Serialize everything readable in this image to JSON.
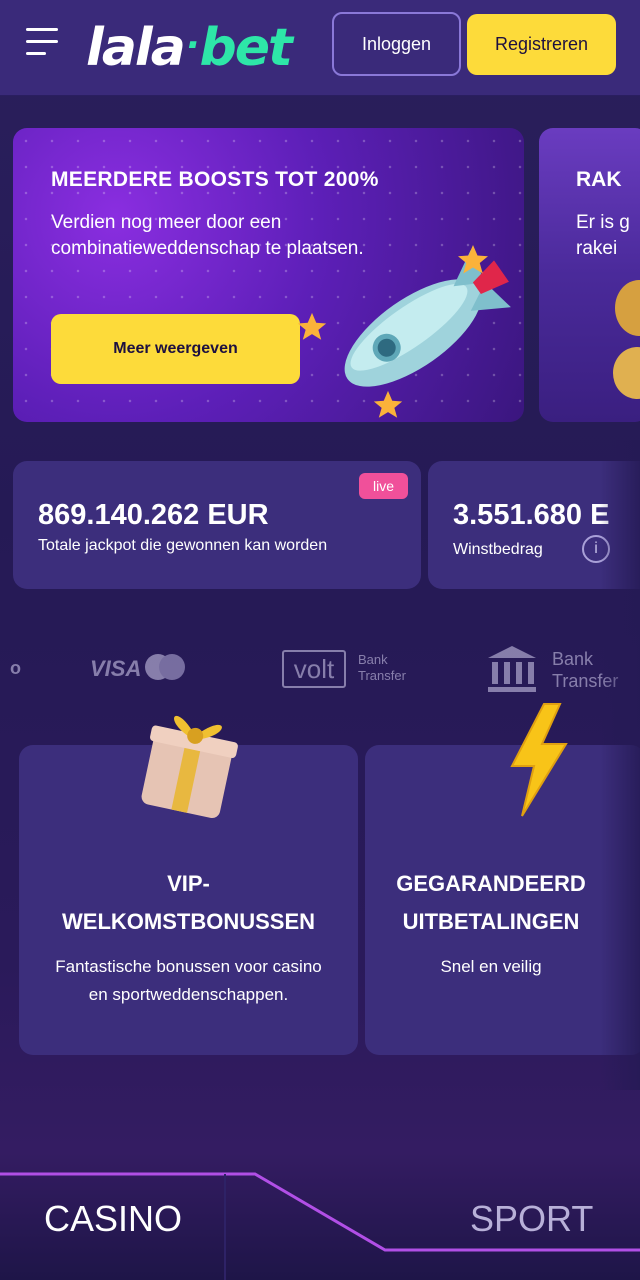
{
  "header": {
    "logo_left": "lala",
    "logo_dot": "·",
    "logo_right": "bet",
    "login_label": "Inloggen",
    "register_label": "Registreren"
  },
  "promos": [
    {
      "title": "MEERDERE BOOSTS TOT 200%",
      "description": "Verdien nog meer door een combinatieweddenschap te plaatsen.",
      "button_label": "Meer weergeven"
    },
    {
      "title": "RAK",
      "description_line1": "Er is g",
      "description_line2": "rakei"
    }
  ],
  "jackpots": [
    {
      "value": "869.140.262 EUR",
      "label": "Totale jackpot die gewonnen kan worden",
      "badge": "live"
    },
    {
      "value": "3.551.680 E",
      "label": "Winstbedrag",
      "info_icon": "i"
    }
  ],
  "payments": {
    "partial": "o",
    "visa": "VISA",
    "volt": "volt",
    "volt_caption_1": "Bank",
    "volt_caption_2": "Transfer",
    "bank_caption_1": "Bank",
    "bank_caption_2": "Transfer"
  },
  "features": [
    {
      "title_line1": "VIP-",
      "title_line2": "WELKOMSTBONUSSEN",
      "description_line1": "Fantastische bonussen voor casino",
      "description_line2": "en sportweddenschappen.",
      "icon": "gift-icon"
    },
    {
      "title_line1": "GEGARANDEERD",
      "title_line2": "UITBETALINGEN",
      "description_line1": "Snel en veilig",
      "icon": "lightning-icon"
    }
  ],
  "tabs": {
    "casino": "CASINO",
    "sport": "SPORT"
  },
  "colors": {
    "accent_yellow": "#fddb3a",
    "logo_green": "#2ee6a8",
    "card_bg": "#3c2e7c",
    "live_pink": "#f0509a"
  }
}
